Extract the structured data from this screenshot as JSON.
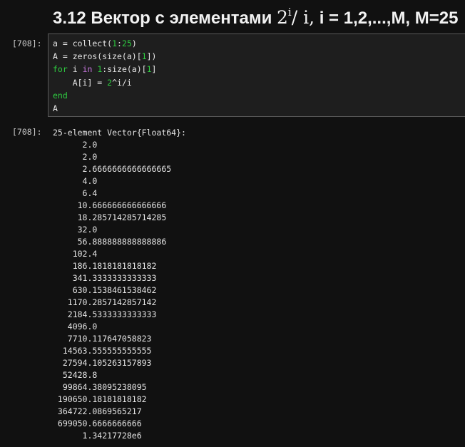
{
  "heading": {
    "prefix": "3.12 Вектор с элементами ",
    "math_base": "2",
    "math_exp": "i",
    "math_tail": "/ i,",
    "suffix": " i = 1,2,...,M, M=25"
  },
  "input_cell": {
    "prompt": "[708]:",
    "lines": [
      "a = collect(1:25)",
      "A = zeros(size(a)[1])",
      "for i in 1:size(a)[1]",
      "    A[i] = 2^i/i",
      "end",
      "A"
    ]
  },
  "output_cell": {
    "prompt": "[708]:",
    "header": "25-element Vector{Float64}:",
    "values": [
      "      2.0",
      "      2.0",
      "      2.6666666666666665",
      "      4.0",
      "      6.4",
      "     10.666666666666666",
      "     18.285714285714285",
      "     32.0",
      "     56.888888888888886",
      "    102.4",
      "    186.1818181818182",
      "    341.3333333333333",
      "    630.1538461538462",
      "   1170.2857142857142",
      "   2184.5333333333333",
      "   4096.0",
      "   7710.117647058823",
      "  14563.555555555555",
      "  27594.105263157893",
      "  52428.8",
      "  99864.38095238095",
      " 190650.18181818182",
      " 364722.0869565217",
      " 699050.6666666666",
      "      1.34217728e6"
    ]
  }
}
